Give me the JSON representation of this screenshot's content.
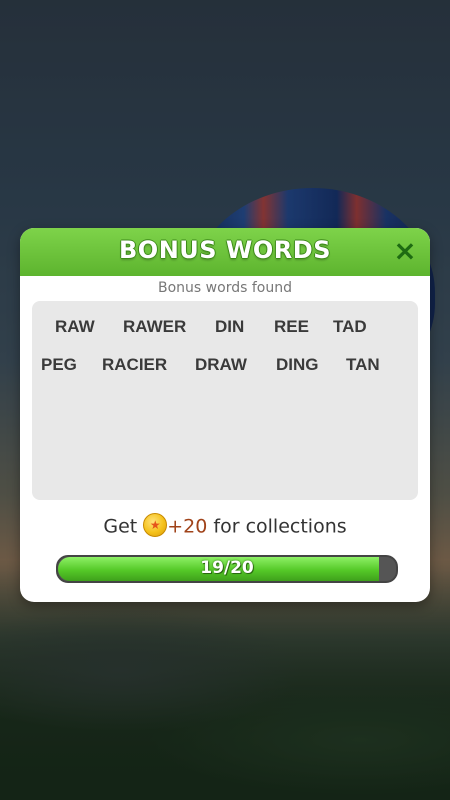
{
  "dialog": {
    "title": "BONUS WORDS",
    "subtitle": "Bonus words found",
    "close_icon": "×"
  },
  "bonus_words": [
    "RAW",
    "RAWER",
    "DIN",
    "REE",
    "TAD",
    "PEG",
    "RACIER",
    "DRAW",
    "DING",
    "TAN"
  ],
  "reward": {
    "prefix": "Get",
    "amount": "+20",
    "suffix": "for collections",
    "coin_icon": "coin-icon"
  },
  "progress": {
    "label": "19/20",
    "current": 19,
    "total": 20
  }
}
